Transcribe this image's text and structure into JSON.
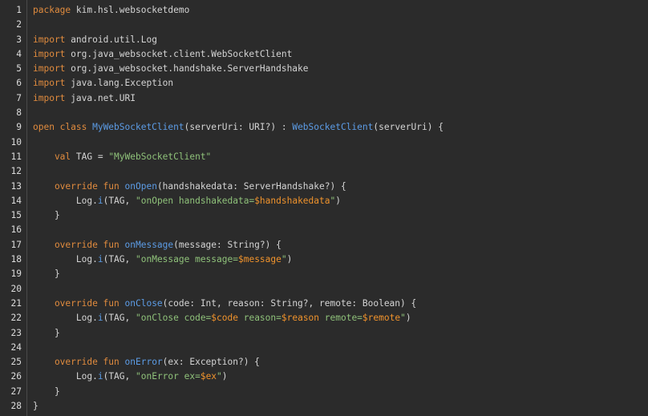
{
  "colors": {
    "background": "#2b2b2b",
    "keyword": "#e08b3e",
    "function": "#5c9ce6",
    "string": "#8fc27a",
    "template_var": "#f0932c",
    "text": "#d4d4d4",
    "line_number": "#dcdcdc"
  },
  "lines": [
    {
      "n": "1",
      "tokens": [
        {
          "t": "package",
          "c": "kw"
        },
        {
          "t": " kim.hsl.websocketdemo",
          "c": "txt"
        }
      ]
    },
    {
      "n": "2",
      "tokens": []
    },
    {
      "n": "3",
      "tokens": [
        {
          "t": "import",
          "c": "kw"
        },
        {
          "t": " android.util.Log",
          "c": "txt"
        }
      ]
    },
    {
      "n": "4",
      "tokens": [
        {
          "t": "import",
          "c": "kw"
        },
        {
          "t": " org.java_websocket.client.WebSocketClient",
          "c": "txt"
        }
      ]
    },
    {
      "n": "5",
      "tokens": [
        {
          "t": "import",
          "c": "kw"
        },
        {
          "t": " org.java_websocket.handshake.ServerHandshake",
          "c": "txt"
        }
      ]
    },
    {
      "n": "6",
      "tokens": [
        {
          "t": "import",
          "c": "kw"
        },
        {
          "t": " java.lang.Exception",
          "c": "txt"
        }
      ]
    },
    {
      "n": "7",
      "tokens": [
        {
          "t": "import",
          "c": "kw"
        },
        {
          "t": " java.net.URI",
          "c": "txt"
        }
      ]
    },
    {
      "n": "8",
      "tokens": []
    },
    {
      "n": "9",
      "tokens": [
        {
          "t": "open class ",
          "c": "kw"
        },
        {
          "t": "MyWebSocketClient",
          "c": "fn"
        },
        {
          "t": "(serverUri: URI?) : ",
          "c": "txt"
        },
        {
          "t": "WebSocketClient",
          "c": "fn"
        },
        {
          "t": "(serverUri) {",
          "c": "txt"
        }
      ]
    },
    {
      "n": "10",
      "tokens": []
    },
    {
      "n": "11",
      "tokens": [
        {
          "t": "    val",
          "c": "kw"
        },
        {
          "t": " TAG = ",
          "c": "txt"
        },
        {
          "t": "\"MyWebSocketClient\"",
          "c": "str"
        }
      ]
    },
    {
      "n": "12",
      "tokens": []
    },
    {
      "n": "13",
      "tokens": [
        {
          "t": "    override fun ",
          "c": "kw"
        },
        {
          "t": "onOpen",
          "c": "fn"
        },
        {
          "t": "(handshakedata: ServerHandshake?) {",
          "c": "txt"
        }
      ]
    },
    {
      "n": "14",
      "tokens": [
        {
          "t": "        Log.",
          "c": "txt"
        },
        {
          "t": "i",
          "c": "fn"
        },
        {
          "t": "(TAG, ",
          "c": "txt"
        },
        {
          "t": "\"onOpen handshakedata=",
          "c": "str"
        },
        {
          "t": "$handshakedata",
          "c": "tmpl"
        },
        {
          "t": "\"",
          "c": "str"
        },
        {
          "t": ")",
          "c": "txt"
        }
      ]
    },
    {
      "n": "15",
      "tokens": [
        {
          "t": "    }",
          "c": "txt"
        }
      ]
    },
    {
      "n": "16",
      "tokens": []
    },
    {
      "n": "17",
      "tokens": [
        {
          "t": "    override fun ",
          "c": "kw"
        },
        {
          "t": "onMessage",
          "c": "fn"
        },
        {
          "t": "(message: String?) {",
          "c": "txt"
        }
      ]
    },
    {
      "n": "18",
      "tokens": [
        {
          "t": "        Log.",
          "c": "txt"
        },
        {
          "t": "i",
          "c": "fn"
        },
        {
          "t": "(TAG, ",
          "c": "txt"
        },
        {
          "t": "\"onMessage message=",
          "c": "str"
        },
        {
          "t": "$message",
          "c": "tmpl"
        },
        {
          "t": "\"",
          "c": "str"
        },
        {
          "t": ")",
          "c": "txt"
        }
      ]
    },
    {
      "n": "19",
      "tokens": [
        {
          "t": "    }",
          "c": "txt"
        }
      ]
    },
    {
      "n": "20",
      "tokens": []
    },
    {
      "n": "21",
      "tokens": [
        {
          "t": "    override fun ",
          "c": "kw"
        },
        {
          "t": "onClose",
          "c": "fn"
        },
        {
          "t": "(code: Int, reason: String?, remote: Boolean) {",
          "c": "txt"
        }
      ]
    },
    {
      "n": "22",
      "tokens": [
        {
          "t": "        Log.",
          "c": "txt"
        },
        {
          "t": "i",
          "c": "fn"
        },
        {
          "t": "(TAG, ",
          "c": "txt"
        },
        {
          "t": "\"onClose code=",
          "c": "str"
        },
        {
          "t": "$code",
          "c": "tmpl"
        },
        {
          "t": " reason=",
          "c": "str"
        },
        {
          "t": "$reason",
          "c": "tmpl"
        },
        {
          "t": " remote=",
          "c": "str"
        },
        {
          "t": "$remote",
          "c": "tmpl"
        },
        {
          "t": "\"",
          "c": "str"
        },
        {
          "t": ")",
          "c": "txt"
        }
      ]
    },
    {
      "n": "23",
      "tokens": [
        {
          "t": "    }",
          "c": "txt"
        }
      ]
    },
    {
      "n": "24",
      "tokens": []
    },
    {
      "n": "25",
      "tokens": [
        {
          "t": "    override fun ",
          "c": "kw"
        },
        {
          "t": "onError",
          "c": "fn"
        },
        {
          "t": "(ex: Exception?) {",
          "c": "txt"
        }
      ]
    },
    {
      "n": "26",
      "tokens": [
        {
          "t": "        Log.",
          "c": "txt"
        },
        {
          "t": "i",
          "c": "fn"
        },
        {
          "t": "(TAG, ",
          "c": "txt"
        },
        {
          "t": "\"onError ex=",
          "c": "str"
        },
        {
          "t": "$ex",
          "c": "tmpl"
        },
        {
          "t": "\"",
          "c": "str"
        },
        {
          "t": ")",
          "c": "txt"
        }
      ]
    },
    {
      "n": "27",
      "tokens": [
        {
          "t": "    }",
          "c": "txt"
        }
      ]
    },
    {
      "n": "28",
      "tokens": [
        {
          "t": "}",
          "c": "txt"
        }
      ]
    }
  ]
}
